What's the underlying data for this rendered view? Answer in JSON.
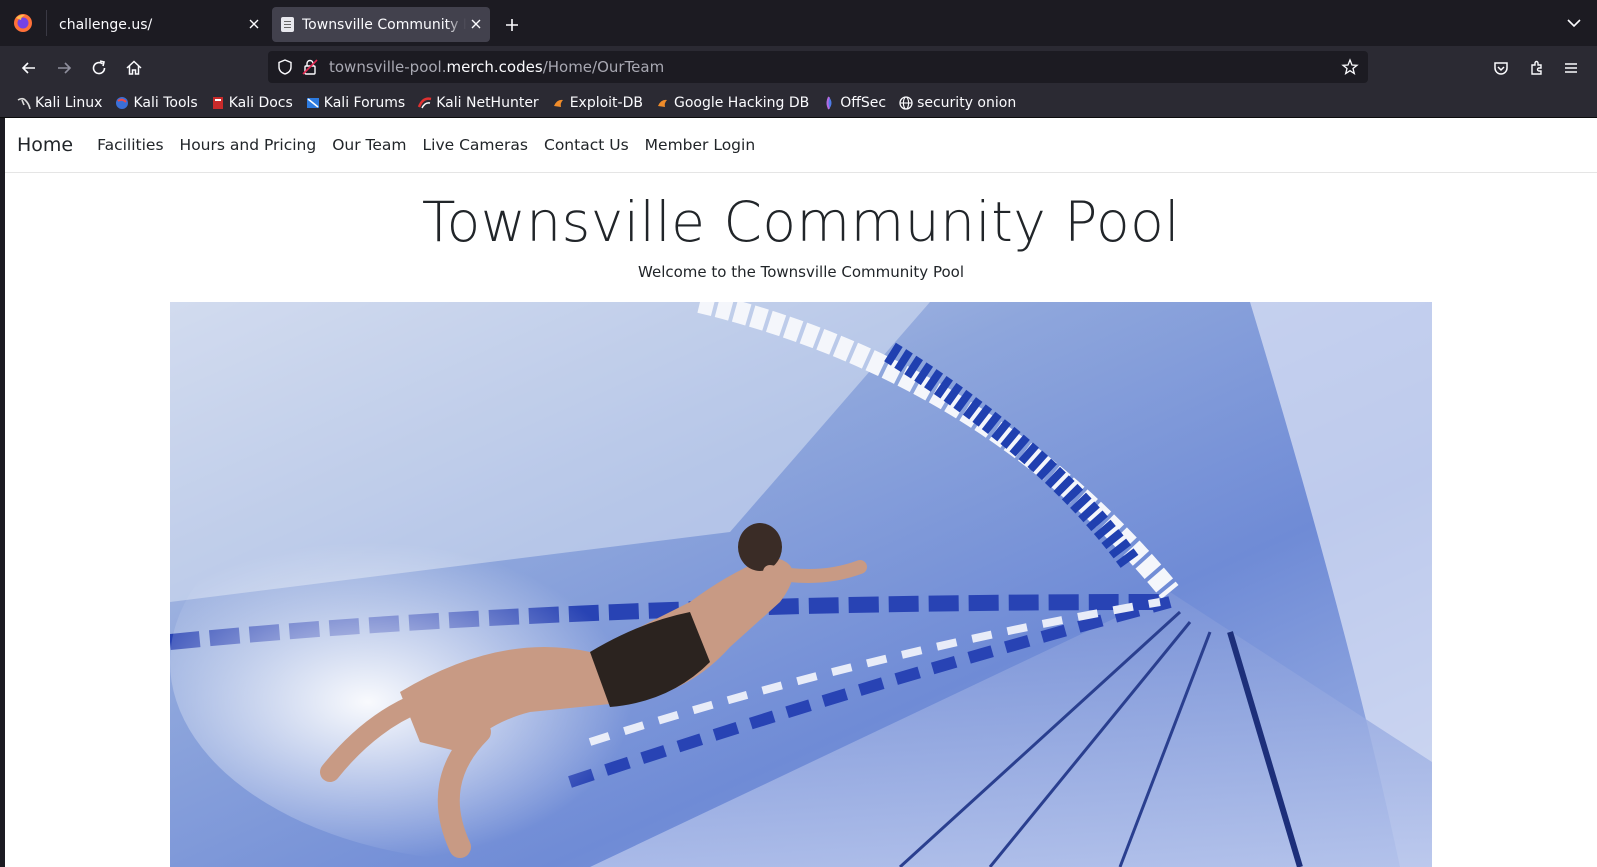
{
  "browser": {
    "tabs": [
      {
        "title": "challenge.us/",
        "active": false
      },
      {
        "title": "Townsville Community Pool",
        "active": true
      }
    ],
    "url": {
      "prefix": "townsville-pool.",
      "host": "merch.codes",
      "path": "/Home/OurTeam"
    },
    "bookmarks": [
      {
        "label": "Kali Linux",
        "icon": "kali-dragon-icon"
      },
      {
        "label": "Kali Tools",
        "icon": "kali-tools-icon"
      },
      {
        "label": "Kali Docs",
        "icon": "kali-docs-icon"
      },
      {
        "label": "Kali Forums",
        "icon": "kali-forums-icon"
      },
      {
        "label": "Kali NetHunter",
        "icon": "nethunter-icon"
      },
      {
        "label": "Exploit-DB",
        "icon": "exploit-db-icon"
      },
      {
        "label": "Google Hacking DB",
        "icon": "ghdb-icon"
      },
      {
        "label": "OffSec",
        "icon": "offsec-icon"
      },
      {
        "label": "security onion",
        "icon": "globe-icon"
      }
    ]
  },
  "site": {
    "brand": "Home",
    "nav": [
      "Facilities",
      "Hours and Pricing",
      "Our Team",
      "Live Cameras",
      "Contact Us",
      "Member Login"
    ],
    "title": "Townsville Community Pool",
    "subtitle": "Welcome to the Townsville Community Pool"
  },
  "colors": {
    "chrome_dark": "#1c1b22",
    "chrome_toolbar": "#2b2a33",
    "active_tab": "#42414d",
    "page_text": "#212529"
  }
}
